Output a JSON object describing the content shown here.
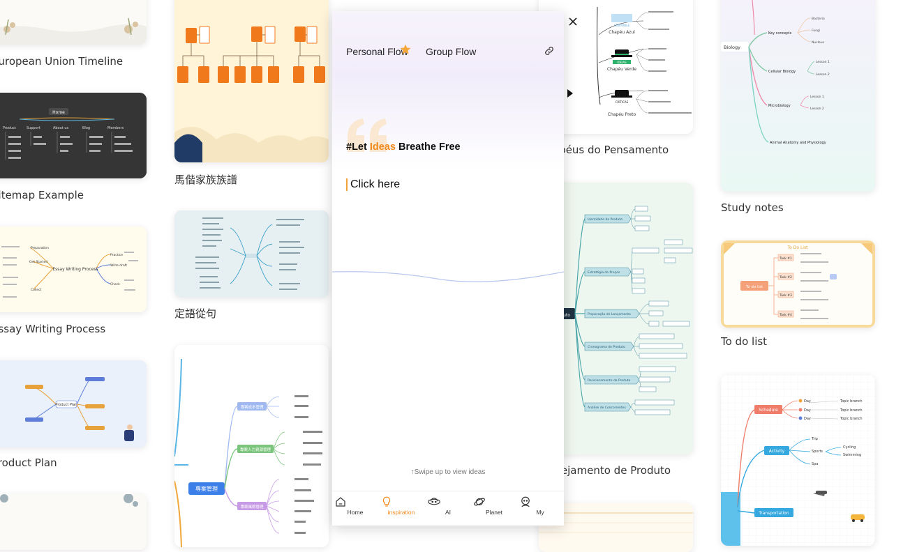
{
  "popup": {
    "tabs": [
      "Personal Flow",
      "Group Flow"
    ],
    "slogan_pre": "#Let ",
    "slogan_hl": "Ideas",
    "slogan_post": " Breathe Free",
    "click_here": "Click here",
    "swipe_hint": "↑Swipe up to view ideas",
    "nav": [
      {
        "label": "Home",
        "icon": "home-icon"
      },
      {
        "label": "inspiration",
        "icon": "lightbulb-icon"
      },
      {
        "label": "AI",
        "icon": "ai-icon"
      },
      {
        "label": "Planet",
        "icon": "planet-icon"
      },
      {
        "label": "My",
        "icon": "profile-icon"
      }
    ],
    "accent": "#f08a1c"
  },
  "cards": {
    "c1": "European Union Timeline",
    "c2": "Sitemap Example",
    "c3": "Essay Writing Process",
    "c4": "Product Plan",
    "c5": "馬偕家族族譜",
    "c6": "定語從句",
    "c7": "Chapéus do Pensamento",
    "c8": "Planejamento de Produto",
    "c9": "Study notes",
    "c10": "To do list"
  },
  "thumbs": {
    "sitemap": {
      "root": "Home",
      "branches": [
        "Product",
        "Support",
        "About us",
        "Blog",
        "Members"
      ]
    },
    "essay": {
      "center": "Essay Writing Process",
      "left": [
        "Preparation",
        "Get Started",
        "Collect"
      ],
      "right": [
        "Practice",
        "Write draft",
        "Check"
      ]
    },
    "product": {
      "center": "Product Plan"
    },
    "study": {
      "root": "Biology",
      "topics": [
        "Key concepts",
        "Cellular Biology",
        "Microbiology",
        "Animal Anatomy and Physiology"
      ],
      "leaves": [
        "Bacteria",
        "Fungi",
        "Nucleus",
        "Lesson 1",
        "Lesson 2",
        "Lesson 1",
        "Lesson 2"
      ]
    },
    "todo": {
      "title": "To Do List",
      "root": "To do list",
      "tasks": [
        "Task #1",
        "Task #2",
        "Task #3",
        "Task #4"
      ]
    },
    "chapeus": {
      "hats": [
        "Chapéu Azul",
        "Chapéu Verde",
        "Chapéu Preto"
      ],
      "tags": [
        "CONTROLE",
        "IDEIAS",
        "CRÍTICAS"
      ]
    },
    "planejamento": {
      "root": "uto",
      "branches": [
        "Identidade de Produto",
        "Estratégia de Preços",
        "Preparação de Lançamento",
        "Cronograma de Produto",
        "Posicionamento de Produto",
        "Análise de Concorrentes"
      ]
    },
    "project": {
      "root": "專案管理",
      "branches": [
        "專案成本管理",
        "專案人力資源管理",
        "專案風險管理"
      ]
    },
    "mind": {
      "branches": [
        "Schedule",
        "Activity",
        "Transportation"
      ],
      "leaves": [
        "Day",
        "Day",
        "Day",
        "Trip",
        "Sports",
        "Spa",
        "Cycling",
        "Swimming"
      ],
      "topic": "Topic branch"
    }
  }
}
